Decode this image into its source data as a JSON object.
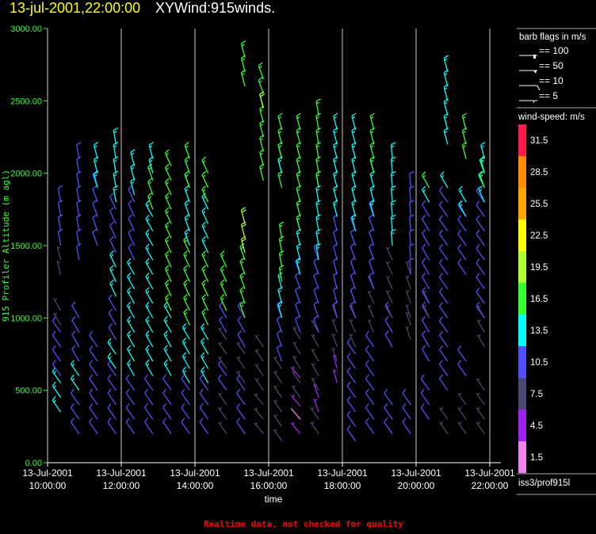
{
  "header": {
    "date_time": "13-jul-2001,22:00:00",
    "plot_name": "XYWind:915winds."
  },
  "footer": {
    "notice": "Realtime data, not checked for quality",
    "notice_color": "#ff0000",
    "source": "iss3/prof915l"
  },
  "legend": {
    "barb_title": "barb flags in m/s",
    "barb_items": [
      {
        "value": 100,
        "label": "== 100"
      },
      {
        "value": 50,
        "label": "== 50"
      },
      {
        "value": 10,
        "label": "== 10"
      },
      {
        "value": 5,
        "label": "== 5"
      }
    ],
    "color_title": "wind-speed: m/s",
    "color_bins": [
      {
        "label": "31.5",
        "color": "#ff1a4a"
      },
      {
        "label": "28.5",
        "color": "#ff8c00"
      },
      {
        "label": "25.5",
        "color": "#ffa500"
      },
      {
        "label": "22.5",
        "color": "#ffff00"
      },
      {
        "label": "19.5",
        "color": "#adff2f"
      },
      {
        "label": "16.5",
        "color": "#33ff33"
      },
      {
        "label": "13.5",
        "color": "#00ffff"
      },
      {
        "label": "10.5",
        "color": "#5050ff"
      },
      {
        "label": "7.5",
        "color": "#484870"
      },
      {
        "label": "4.5",
        "color": "#a020f0"
      },
      {
        "label": "1.5",
        "color": "#ee82ee"
      }
    ]
  },
  "chart_data": {
    "type": "wind-barb",
    "title": "XYWind:915winds.",
    "xlabel": "time",
    "ylabel": "915 Profiler Altitude (m agl)",
    "xlim_hours": [
      10,
      22
    ],
    "ylim": [
      0,
      3000
    ],
    "yticks": [
      "3000.00",
      "2500.00",
      "2000.00",
      "1500.00",
      "1000.00",
      "500.00",
      "0.00"
    ],
    "xticks": [
      {
        "date": "13-Jul-2001",
        "time": "10:00:00"
      },
      {
        "date": "13-Jul-2001",
        "time": "12:00:00"
      },
      {
        "date": "13-Jul-2001",
        "time": "14:00:00"
      },
      {
        "date": "13-Jul-2001",
        "time": "16:00:00"
      },
      {
        "date": "13-Jul-2001",
        "time": "18:00:00"
      },
      {
        "date": "13-Jul-2001",
        "time": "20:00:00"
      },
      {
        "date": "13-Jul-2001",
        "time": "22:00:00"
      }
    ],
    "gate_spacing_m": 100,
    "profiles_note": "segments: [alt_from, alt_to, speed m/s, direction deg]",
    "profiles": [
      {
        "hour": 10.25,
        "segments": [
          [
            350,
            550,
            13,
            325
          ],
          [
            600,
            900,
            10,
            325
          ],
          [
            950,
            1100,
            7,
            330
          ],
          [
            1300,
            1450,
            7,
            345
          ],
          [
            1500,
            1800,
            10,
            350
          ]
        ]
      },
      {
        "hour": 10.75,
        "segments": [
          [
            200,
            450,
            10,
            325
          ],
          [
            500,
            650,
            13,
            325
          ],
          [
            700,
            1000,
            10,
            330
          ],
          [
            1400,
            2100,
            10,
            350
          ]
        ]
      },
      {
        "hour": 11.25,
        "segments": [
          [
            200,
            800,
            10,
            325
          ],
          [
            1500,
            1900,
            10,
            340
          ],
          [
            1900,
            2100,
            13,
            345
          ]
        ]
      },
      {
        "hour": 11.75,
        "segments": [
          [
            200,
            600,
            10,
            325
          ],
          [
            650,
            800,
            13,
            325
          ],
          [
            850,
            1100,
            10,
            330
          ],
          [
            1150,
            1350,
            13,
            335
          ],
          [
            1450,
            1750,
            10,
            335
          ],
          [
            1800,
            2200,
            13,
            350
          ]
        ]
      },
      {
        "hour": 12.25,
        "segments": [
          [
            200,
            550,
            10,
            325
          ],
          [
            600,
            1300,
            13,
            330
          ],
          [
            1400,
            1800,
            10,
            335
          ],
          [
            1850,
            2100,
            13,
            345
          ]
        ]
      },
      {
        "hour": 12.75,
        "segments": [
          [
            200,
            550,
            10,
            325
          ],
          [
            600,
            1700,
            13,
            330
          ],
          [
            1750,
            2000,
            16,
            340
          ],
          [
            2000,
            2100,
            13,
            345
          ]
        ]
      },
      {
        "hour": 13.25,
        "segments": [
          [
            200,
            550,
            10,
            325
          ],
          [
            600,
            1000,
            13,
            330
          ],
          [
            1050,
            2050,
            16,
            335
          ]
        ]
      },
      {
        "hour": 13.75,
        "segments": [
          [
            200,
            500,
            10,
            325
          ],
          [
            550,
            900,
            13,
            330
          ],
          [
            950,
            1450,
            16,
            335
          ],
          [
            1500,
            1900,
            13,
            340
          ],
          [
            1900,
            2100,
            16,
            340
          ]
        ]
      },
      {
        "hour": 14.25,
        "segments": [
          [
            200,
            500,
            10,
            325
          ],
          [
            550,
            900,
            13,
            330
          ],
          [
            950,
            1400,
            16,
            335
          ],
          [
            1450,
            1800,
            13,
            335
          ],
          [
            1800,
            2000,
            16,
            335
          ]
        ]
      },
      {
        "hour": 14.75,
        "segments": [
          [
            200,
            450,
            7,
            325
          ],
          [
            500,
            600,
            10,
            325
          ],
          [
            650,
            850,
            7,
            325
          ],
          [
            900,
            1000,
            10,
            330
          ],
          [
            1050,
            1400,
            16,
            335
          ]
        ]
      },
      {
        "hour": 15.25,
        "segments": [
          [
            200,
            500,
            10,
            325
          ],
          [
            550,
            800,
            7,
            325
          ],
          [
            800,
            1000,
            10,
            330
          ],
          [
            1000,
            1450,
            16,
            340
          ],
          [
            1450,
            1700,
            19,
            345
          ],
          [
            2600,
            2800,
            16,
            345
          ]
        ]
      },
      {
        "hour": 15.75,
        "segments": [
          [
            200,
            450,
            7,
            320
          ],
          [
            500,
            800,
            7,
            325
          ],
          [
            1950,
            2450,
            16,
            345
          ],
          [
            2450,
            2500,
            19,
            345
          ],
          [
            2550,
            2700,
            16,
            340
          ]
        ]
      },
      {
        "hour": 16.25,
        "segments": [
          [
            150,
            700,
            7,
            325
          ],
          [
            700,
            1000,
            10,
            340
          ],
          [
            1000,
            1250,
            13,
            345
          ],
          [
            1250,
            1600,
            16,
            350
          ],
          [
            1900,
            2000,
            16,
            345
          ],
          [
            2000,
            2100,
            13,
            345
          ],
          [
            2100,
            2300,
            16,
            345
          ]
        ]
      },
      {
        "hour": 16.75,
        "segments": [
          [
            200,
            200,
            4,
            320
          ],
          [
            300,
            300,
            1,
            320
          ],
          [
            390,
            390,
            4,
            320
          ],
          [
            450,
            550,
            7,
            325
          ],
          [
            585,
            585,
            4,
            320
          ],
          [
            650,
            900,
            7,
            330
          ],
          [
            900,
            1300,
            10,
            340
          ],
          [
            1300,
            1600,
            13,
            345
          ],
          [
            1600,
            2300,
            16,
            345
          ]
        ]
      },
      {
        "hour": 17.25,
        "segments": [
          [
            200,
            300,
            7,
            325
          ],
          [
            350,
            450,
            4,
            340
          ],
          [
            500,
            900,
            7,
            330
          ],
          [
            900,
            1400,
            10,
            340
          ],
          [
            1400,
            1900,
            13,
            350
          ],
          [
            1900,
            2400,
            16,
            350
          ]
        ]
      },
      {
        "hour": 17.75,
        "segments": [
          [
            550,
            700,
            4,
            345
          ],
          [
            700,
            1000,
            7,
            340
          ],
          [
            1000,
            1700,
            10,
            345
          ],
          [
            1700,
            2300,
            13,
            345
          ]
        ]
      },
      {
        "hour": 18.25,
        "segments": [
          [
            150,
            800,
            10,
            325
          ],
          [
            800,
            1000,
            7,
            335
          ],
          [
            1000,
            1600,
            10,
            340
          ],
          [
            1600,
            2300,
            13,
            345
          ]
        ]
      },
      {
        "hour": 18.75,
        "segments": [
          [
            200,
            800,
            10,
            325
          ],
          [
            900,
            1200,
            7,
            335
          ],
          [
            1200,
            1700,
            10,
            340
          ],
          [
            1700,
            2000,
            13,
            345
          ],
          [
            2000,
            2300,
            16,
            345
          ]
        ]
      },
      {
        "hour": 19.25,
        "segments": [
          [
            200,
            450,
            10,
            325
          ],
          [
            800,
            1000,
            10,
            330
          ],
          [
            1000,
            1400,
            7,
            335
          ],
          [
            1500,
            2100,
            13,
            355
          ]
        ]
      },
      {
        "hour": 19.75,
        "segments": [
          [
            200,
            450,
            10,
            325
          ],
          [
            850,
            1000,
            7,
            340
          ],
          [
            1000,
            1300,
            7,
            340
          ],
          [
            1300,
            1900,
            10,
            355
          ]
        ]
      },
      {
        "hour": 20.25,
        "segments": [
          [
            300,
            550,
            10,
            325
          ],
          [
            700,
            1000,
            10,
            330
          ],
          [
            1000,
            1100,
            7,
            335
          ],
          [
            1100,
            1700,
            10,
            330
          ],
          [
            1800,
            1800,
            13,
            330
          ],
          [
            1900,
            1900,
            16,
            330
          ]
        ]
      },
      {
        "hour": 20.75,
        "segments": [
          [
            200,
            300,
            7,
            325
          ],
          [
            500,
            1800,
            10,
            325
          ],
          [
            1900,
            1900,
            13,
            330
          ],
          [
            2200,
            2400,
            13,
            345
          ],
          [
            2500,
            2700,
            13,
            345
          ]
        ]
      },
      {
        "hour": 21.25,
        "segments": [
          [
            200,
            400,
            7,
            325
          ],
          [
            600,
            700,
            10,
            325
          ],
          [
            1300,
            1700,
            10,
            325
          ],
          [
            1700,
            1800,
            13,
            330
          ],
          [
            2100,
            2300,
            16,
            345
          ]
        ]
      },
      {
        "hour": 21.75,
        "segments": [
          [
            200,
            500,
            7,
            325
          ],
          [
            800,
            1000,
            7,
            330
          ],
          [
            1000,
            1800,
            10,
            325
          ],
          [
            1800,
            1900,
            13,
            335
          ],
          [
            1900,
            2000,
            16,
            340
          ],
          [
            2000,
            2100,
            13,
            345
          ]
        ]
      }
    ]
  }
}
